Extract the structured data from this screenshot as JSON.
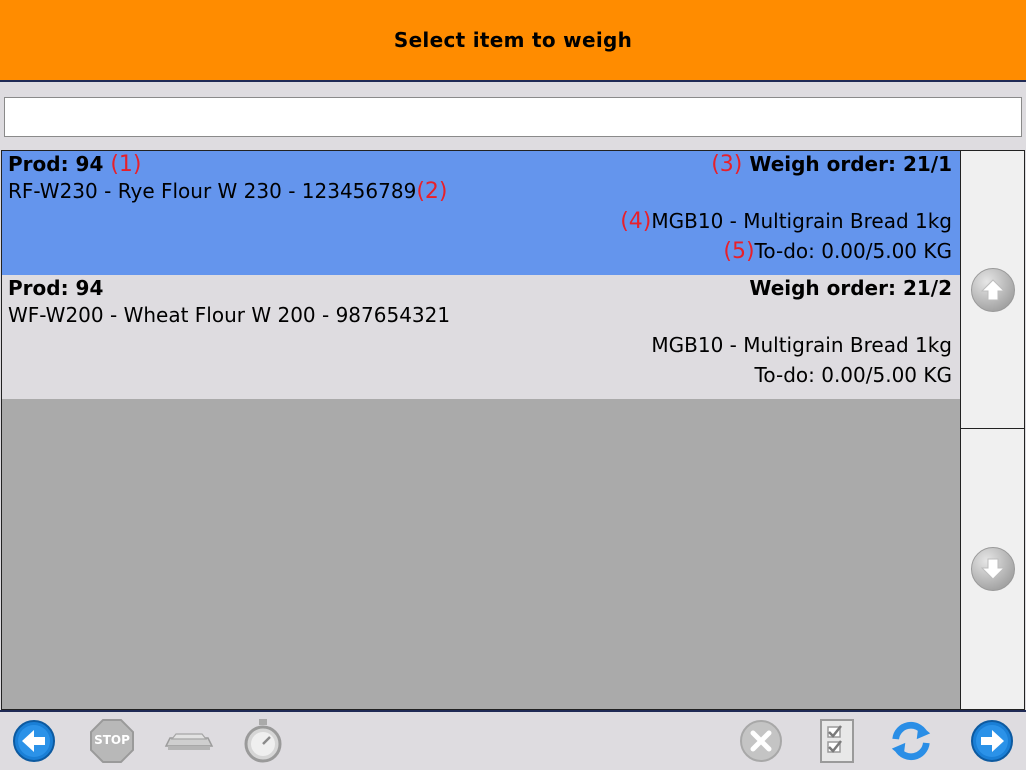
{
  "header": {
    "title": "Select item to weigh"
  },
  "search": {
    "value": "",
    "placeholder": ""
  },
  "items": [
    {
      "prod": "Prod: 94",
      "prod_ann": "(1)",
      "product_line": "RF-W230 - Rye Flour W 230 - 123456789",
      "product_ann": "(2)",
      "order_ann": "(3)",
      "weigh_order": "Weigh order: 21/1",
      "recipe_ann": "(4)",
      "recipe": "MGB10 - Multigrain Bread 1kg",
      "todo_ann": "(5)",
      "todo": "To-do: 0.00/5.00 KG",
      "selected": true
    },
    {
      "prod": "Prod: 94",
      "product_line": "WF-W200 - Wheat Flour W 200 - 987654321",
      "weigh_order": "Weigh order: 21/2",
      "recipe": "MGB10 - Multigrain Bread 1kg",
      "todo": "To-do: 0.00/5.00 KG",
      "selected": false
    }
  ],
  "scroll": {
    "up_icon": "arrow-up-icon",
    "down_icon": "arrow-down-icon"
  },
  "toolbar": {
    "stop_label": "STOP",
    "icons": [
      "back-arrow-icon",
      "stop-icon",
      "scale-icon",
      "stopwatch-icon",
      "cancel-icon",
      "checklist-icon",
      "refresh-icon",
      "forward-arrow-icon"
    ]
  },
  "colors": {
    "header": "#ff8c00",
    "selected_row": "#6495ed",
    "row": "#dedce0",
    "empty_list": "#aaaaaa",
    "annotation": "#e8202a",
    "nav_blue": "#1a7fd6"
  }
}
